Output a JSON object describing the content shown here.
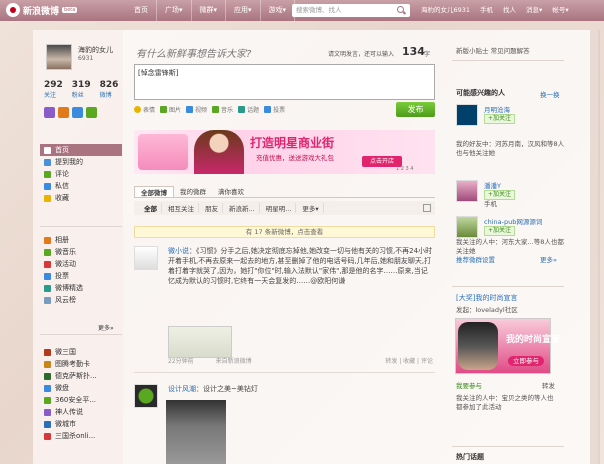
{
  "topbar": {
    "logo_text": "新浪微博",
    "beta_badge": "beta",
    "nav": [
      "首页",
      "广场▾",
      "微群▾",
      "应用▾",
      "游戏▾"
    ],
    "search_placeholder": "搜索微博、找人",
    "user_nav": [
      "海豹的女儿6931",
      "手机",
      "找人",
      "消息▾",
      "帐号▾"
    ]
  },
  "profile": {
    "name": "海豹的女儿",
    "id": "6931",
    "stats": [
      {
        "count": "292",
        "label": "关注"
      },
      {
        "count": "319",
        "label": "粉丝"
      },
      {
        "count": "826",
        "label": "微博"
      }
    ]
  },
  "left_menu": {
    "primary": [
      "首页",
      "提到我的",
      "评论",
      "私信",
      "收藏"
    ],
    "secondary": [
      "相册",
      "微音乐",
      "微活动",
      "投票",
      "微博精选",
      "风云榜"
    ],
    "apps": [
      "微三国",
      "图腾考勤卡",
      "德克萨斯扑...",
      "微盘",
      "360安全平...",
      "神人传说",
      "微城市",
      "三国杀onli..."
    ],
    "more_label": "更多»"
  },
  "compose": {
    "title": "有什么新鲜事想告诉大家?",
    "hint": "请文明发言，还可以输入",
    "count": "134",
    "unit": "字",
    "content": "[悼念雷锋斯]",
    "tools": [
      "表情",
      "图片",
      "视频",
      "音乐",
      "话题",
      "投票"
    ],
    "publish_label": "发布"
  },
  "banner": {
    "title": "打造明星商业街",
    "subtitle": "充值优惠，送送游戏大礼包",
    "button": "点击开店",
    "dots": "1 2 3 4"
  },
  "feed_tabs": {
    "main": [
      "全部微博",
      "我的微群",
      "满你喜欢"
    ],
    "filters": [
      "全部",
      "相互关注",
      "朋友",
      "新浪新...",
      "明星明...",
      "更多▾"
    ]
  },
  "new_notice": "有 17 条新微博，点击查看",
  "posts": [
    {
      "author": "微小说",
      "text": "：《习惯》分手之后,她决定彻底忘掉他,她改变一切与他有关的习惯,不再24小时开着手机,不再去原来一起去的地方,甚至删掉了他的电话号码,几年后,她和朋友聊天,打着打着字就哭了,因为，她打\"你位\"时,输入法默认\"家伟\",那是他的名字……原来,当记忆成为默认的习惯时,它终有一天会复发的……@欧阳何谦",
      "time": "22分钟前",
      "source": "来自新浪微博",
      "actions": "转发 | 收藏 | 评论"
    },
    {
      "author": "设计风潮",
      "text": "：设计之美~美钻灯"
    }
  ],
  "right": {
    "tip_link": "新版小贴士 常见问题解答",
    "suggest_title": "可能感兴趣的人",
    "suggest_more": "换一换",
    "people": [
      {
        "name": "月明沧海",
        "follow": "+加关注",
        "note": "我的好友中：河苏月南，汉风和等8人也与他关注她"
      },
      {
        "name": "潘潘Y",
        "follow": "+加关注",
        "note": "手机"
      },
      {
        "name": "china-pub网源源词",
        "follow": "+加关注",
        "note": "我关注的人中：河东大家...等8人也都关注她"
      }
    ],
    "suggest_footer": "推荐微群设置",
    "suggest_footer_more": "更多»",
    "event_title": "[大奖]我的时尚宣言",
    "event_from": "发起：loveladyl社区",
    "ad_title": "我的时尚宣言",
    "ad_button": "立即参与",
    "join_label": "我要参与",
    "forward_label": "转发",
    "event_note": "我关注的人中：宝贝之类的等人也都参加了此活动",
    "hot_title": "热门话题"
  },
  "colors": {
    "accent": "#a97480",
    "publish_green": "#5aa822",
    "link_blue": "#2a70b8",
    "banner_pink": "#e0246e"
  }
}
